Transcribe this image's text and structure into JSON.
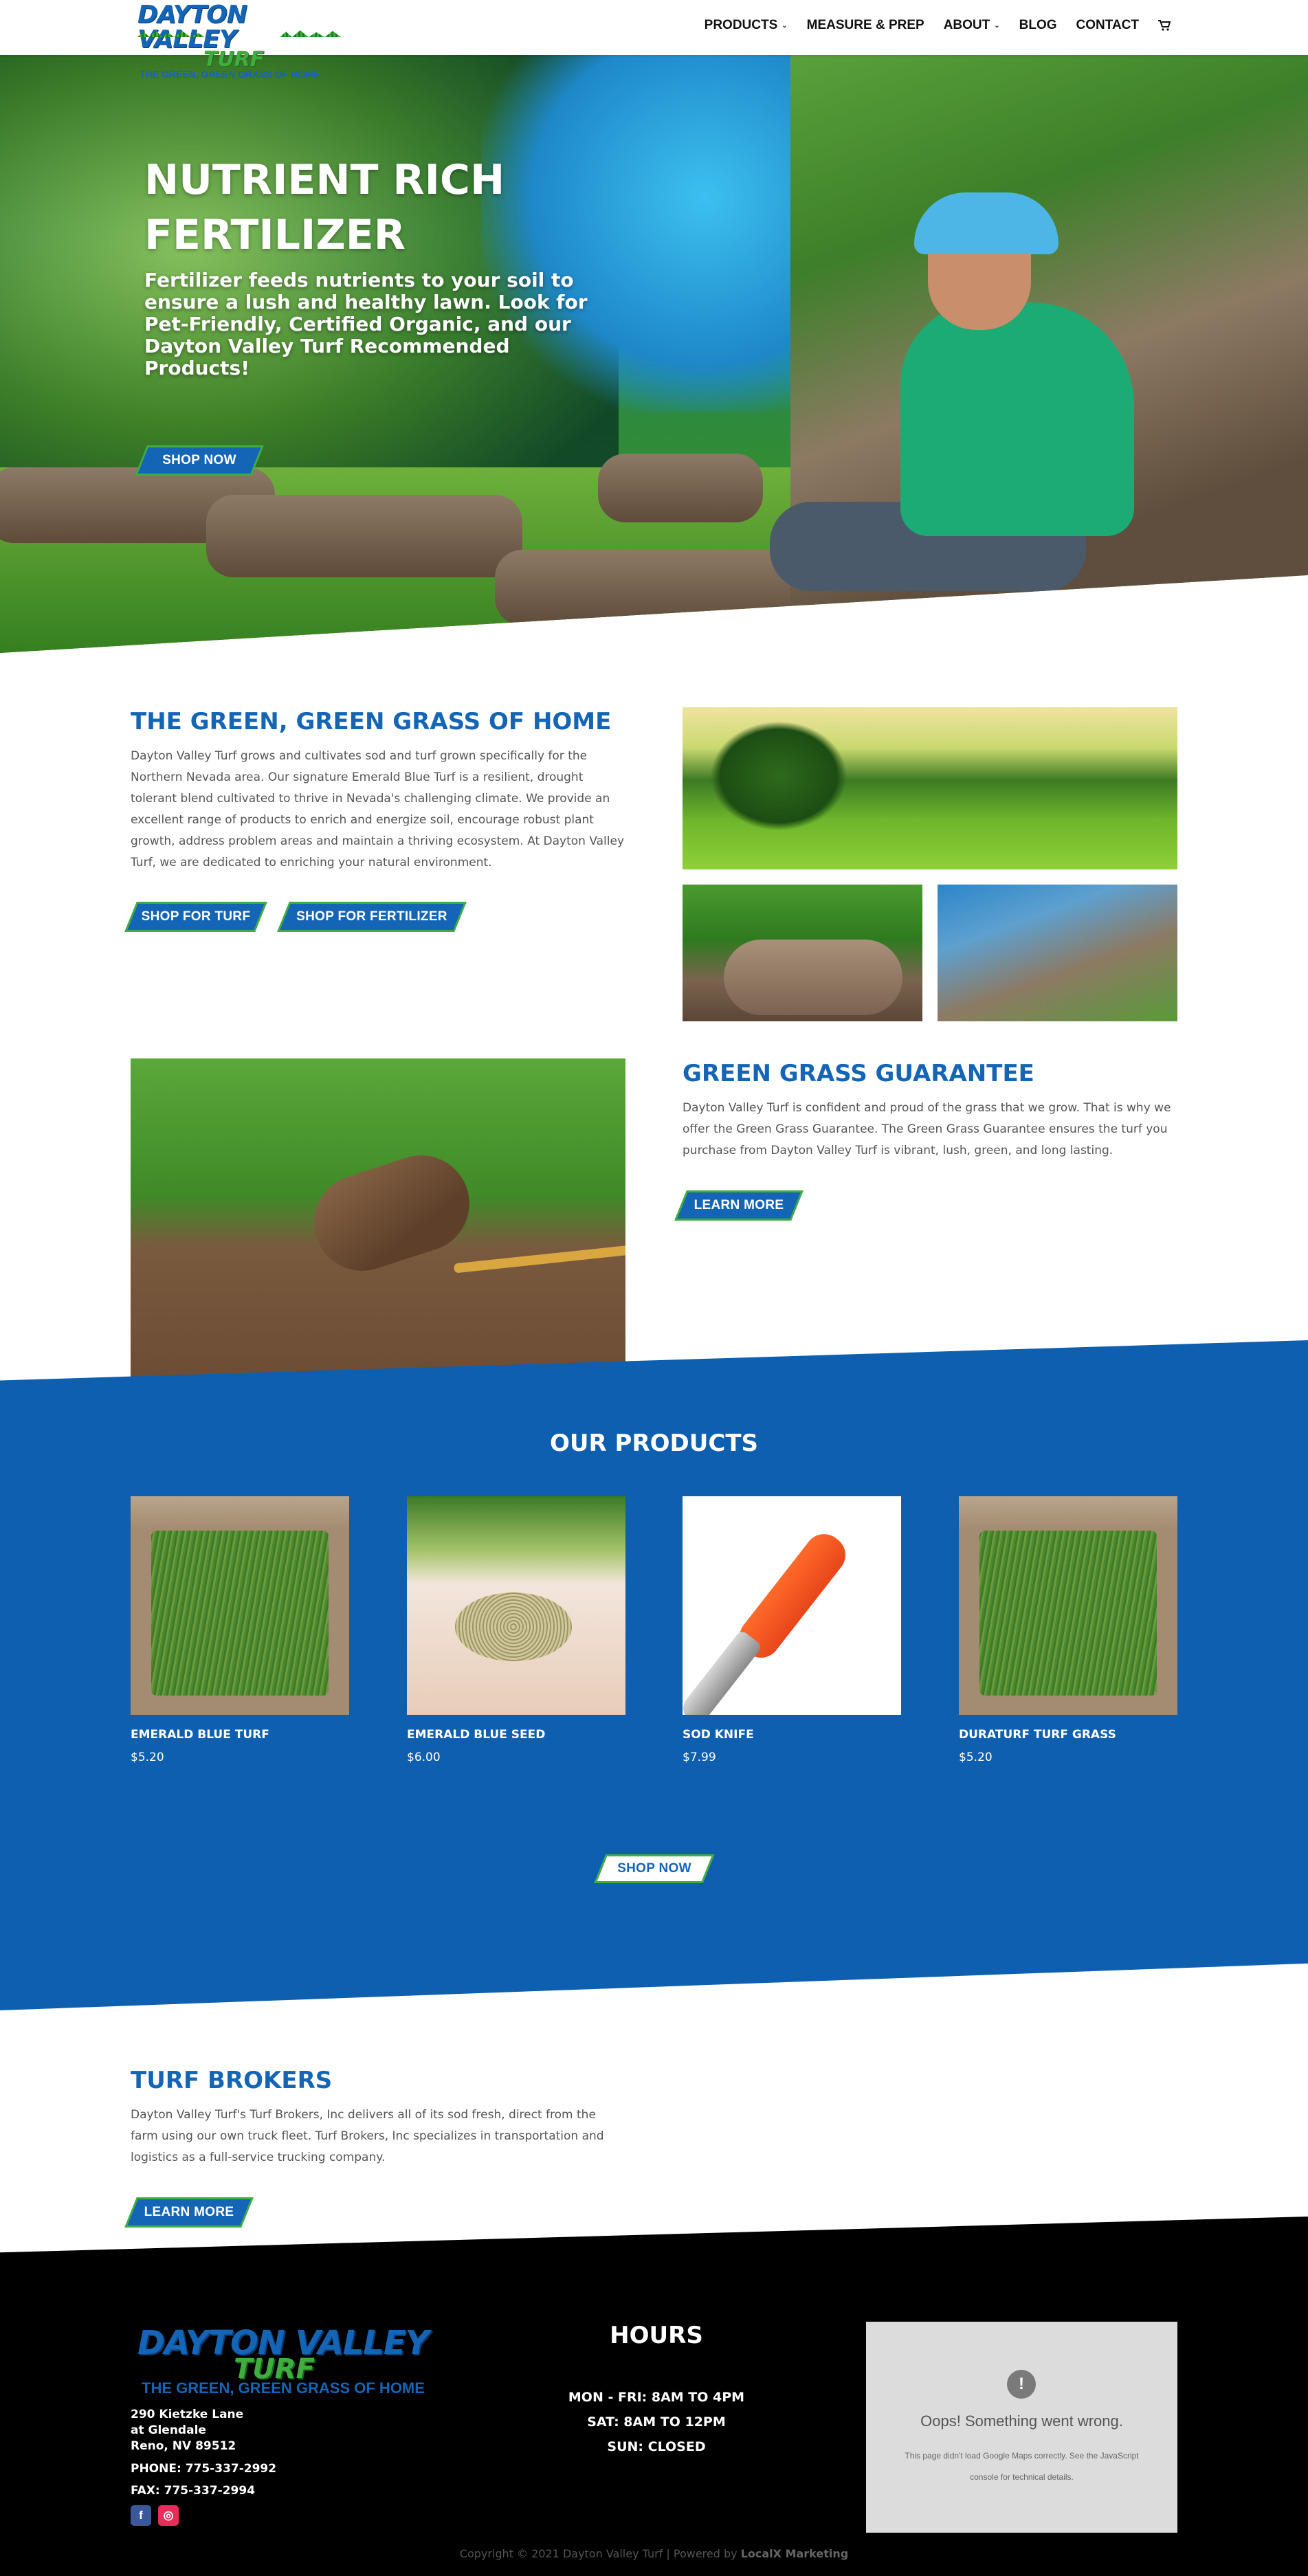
{
  "brand": {
    "logo_line1": "DAYTON VALLEY",
    "logo_line2": "TURF",
    "tagline": "THE GREEN, GREEN GRASS OF HOME"
  },
  "nav": {
    "items": [
      {
        "label": "PRODUCTS",
        "has_dropdown": true
      },
      {
        "label": "MEASURE & PREP",
        "has_dropdown": false
      },
      {
        "label": "ABOUT",
        "has_dropdown": true
      },
      {
        "label": "BLOG",
        "has_dropdown": false
      },
      {
        "label": "CONTACT",
        "has_dropdown": false
      }
    ],
    "cart_icon": "cart-icon"
  },
  "hero": {
    "title": "NUTRIENT RICH FERTILIZER",
    "text": "Fertilizer feeds nutrients to your soil to ensure a lush and healthy lawn. Look for Pet-Friendly, Certified Organic, and our Dayton Valley Turf Recommended Products!",
    "button": "SHOP NOW"
  },
  "intro": {
    "heading": "THE GREEN, GREEN GRASS OF HOME",
    "body": "Dayton Valley Turf grows and cultivates sod and turf grown specifically for the Northern Nevada area. Our signature Emerald Blue Turf is a resilient, drought tolerant blend cultivated to thrive in Nevada's challenging climate. We provide an excellent range of products to enrich and energize soil, encourage robust plant growth, address problem areas and maintain a thriving ecosystem. At Dayton Valley Turf, we are dedicated to enriching your natural environment.",
    "button_turf": "SHOP FOR TURF",
    "button_fertilizer": "SHOP FOR FERTILIZER"
  },
  "guarantee": {
    "heading": "GREEN GRASS GUARANTEE",
    "body": "Dayton Valley Turf is confident and proud of the grass that we grow. That is why we offer the Green Grass Guarantee. The Green Grass Guarantee ensures the turf you purchase from Dayton Valley Turf is vibrant, lush, green, and long lasting.",
    "button": "LEARN MORE"
  },
  "products": {
    "heading": "OUR PRODUCTS",
    "items": [
      {
        "name": "EMERALD BLUE TURF",
        "price": "$5.20"
      },
      {
        "name": "EMERALD BLUE SEED",
        "price": "$6.00"
      },
      {
        "name": "SOD KNIFE",
        "price": "$7.99"
      },
      {
        "name": "DURATURF TURF GRASS",
        "price": "$5.20"
      }
    ],
    "button": "SHOP NOW"
  },
  "brokers": {
    "heading": "TURF BROKERS",
    "body": "Dayton Valley Turf's Turf Brokers, Inc delivers all of its sod fresh, direct from the farm using our own truck fleet. Turf Brokers, Inc specializes in transportation and logistics as a full-service trucking company.",
    "button": "LEARN MORE"
  },
  "footer": {
    "address_line1": "290 Kietzke Lane",
    "address_line2": "at Glendale",
    "address_line3": "Reno, NV 89512",
    "phone": "PHONE: 775-337-2992",
    "fax": "FAX: 775-337-2994",
    "social": [
      {
        "label": "f",
        "icon": "facebook-icon",
        "color": "#3b5998"
      },
      {
        "label": "◎",
        "icon": "instagram-icon",
        "color": "#ea2c59"
      }
    ],
    "hours_title": "HOURS",
    "hours": [
      "MON - FRI: 8AM TO 4PM",
      "SAT: 8AM TO 12PM",
      "SUN: CLOSED"
    ],
    "map_error_title": "Oops! Something went wrong.",
    "map_error_text": "This page didn't load Google Maps correctly. See the JavaScript console for technical details.",
    "copyright": "Copyright © 2021 Dayton Valley Turf | Powered by",
    "powered_by": "LocalX Marketing"
  },
  "colors": {
    "brand_blue": "#1565b6",
    "brand_green": "#3fae3f",
    "footer_bg": "#000000"
  }
}
